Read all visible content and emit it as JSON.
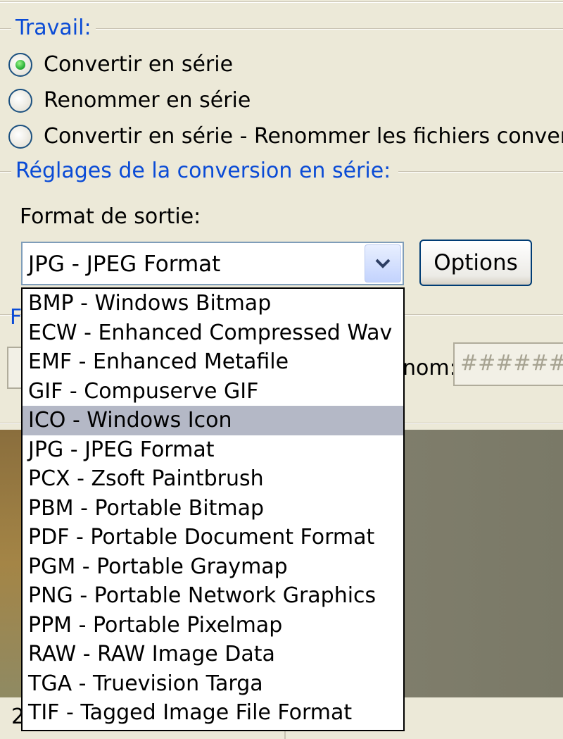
{
  "travail": {
    "label": "Travail:",
    "options": [
      {
        "label": "Convertir en série",
        "selected": true
      },
      {
        "label": "Renommer en série",
        "selected": false
      },
      {
        "label": "Convertir en série - Renommer les fichiers conver",
        "selected": false
      }
    ]
  },
  "reglages": {
    "label": "Réglages de la conversion en série:",
    "format_label": "Format de sortie:",
    "selected_format": "JPG - JPEG Format",
    "options_button": "Options",
    "formats": [
      "BMP - Windows Bitmap",
      "ECW - Enhanced Compressed Wav",
      "EMF - Enhanced Metafile",
      "GIF - Compuserve GIF",
      "ICO - Windows Icon",
      "JPG - JPEG Format",
      "PCX - Zsoft Paintbrush",
      "PBM - Portable Bitmap",
      "PDF - Portable Document Format",
      "PGM - Portable Graymap",
      "PNG - Portable Network Graphics",
      "PPM - Portable Pixelmap",
      "RAW - RAW Image Data",
      "TGA - Truevision Targa",
      "TIF - Tagged Image File Format"
    ],
    "highlighted_format": "ICO - Windows Icon"
  },
  "background": {
    "obscured_label_fragment": "F",
    "name_label_fragment": "nom:",
    "name_value": "########",
    "bottom_fragment": "2"
  },
  "colors": {
    "group_label": "#0a4bd6",
    "window_bg": "#ece9d8",
    "highlight": "#b4b8c6"
  },
  "icons": {
    "dropdown_arrow": "chevron-down-icon"
  }
}
